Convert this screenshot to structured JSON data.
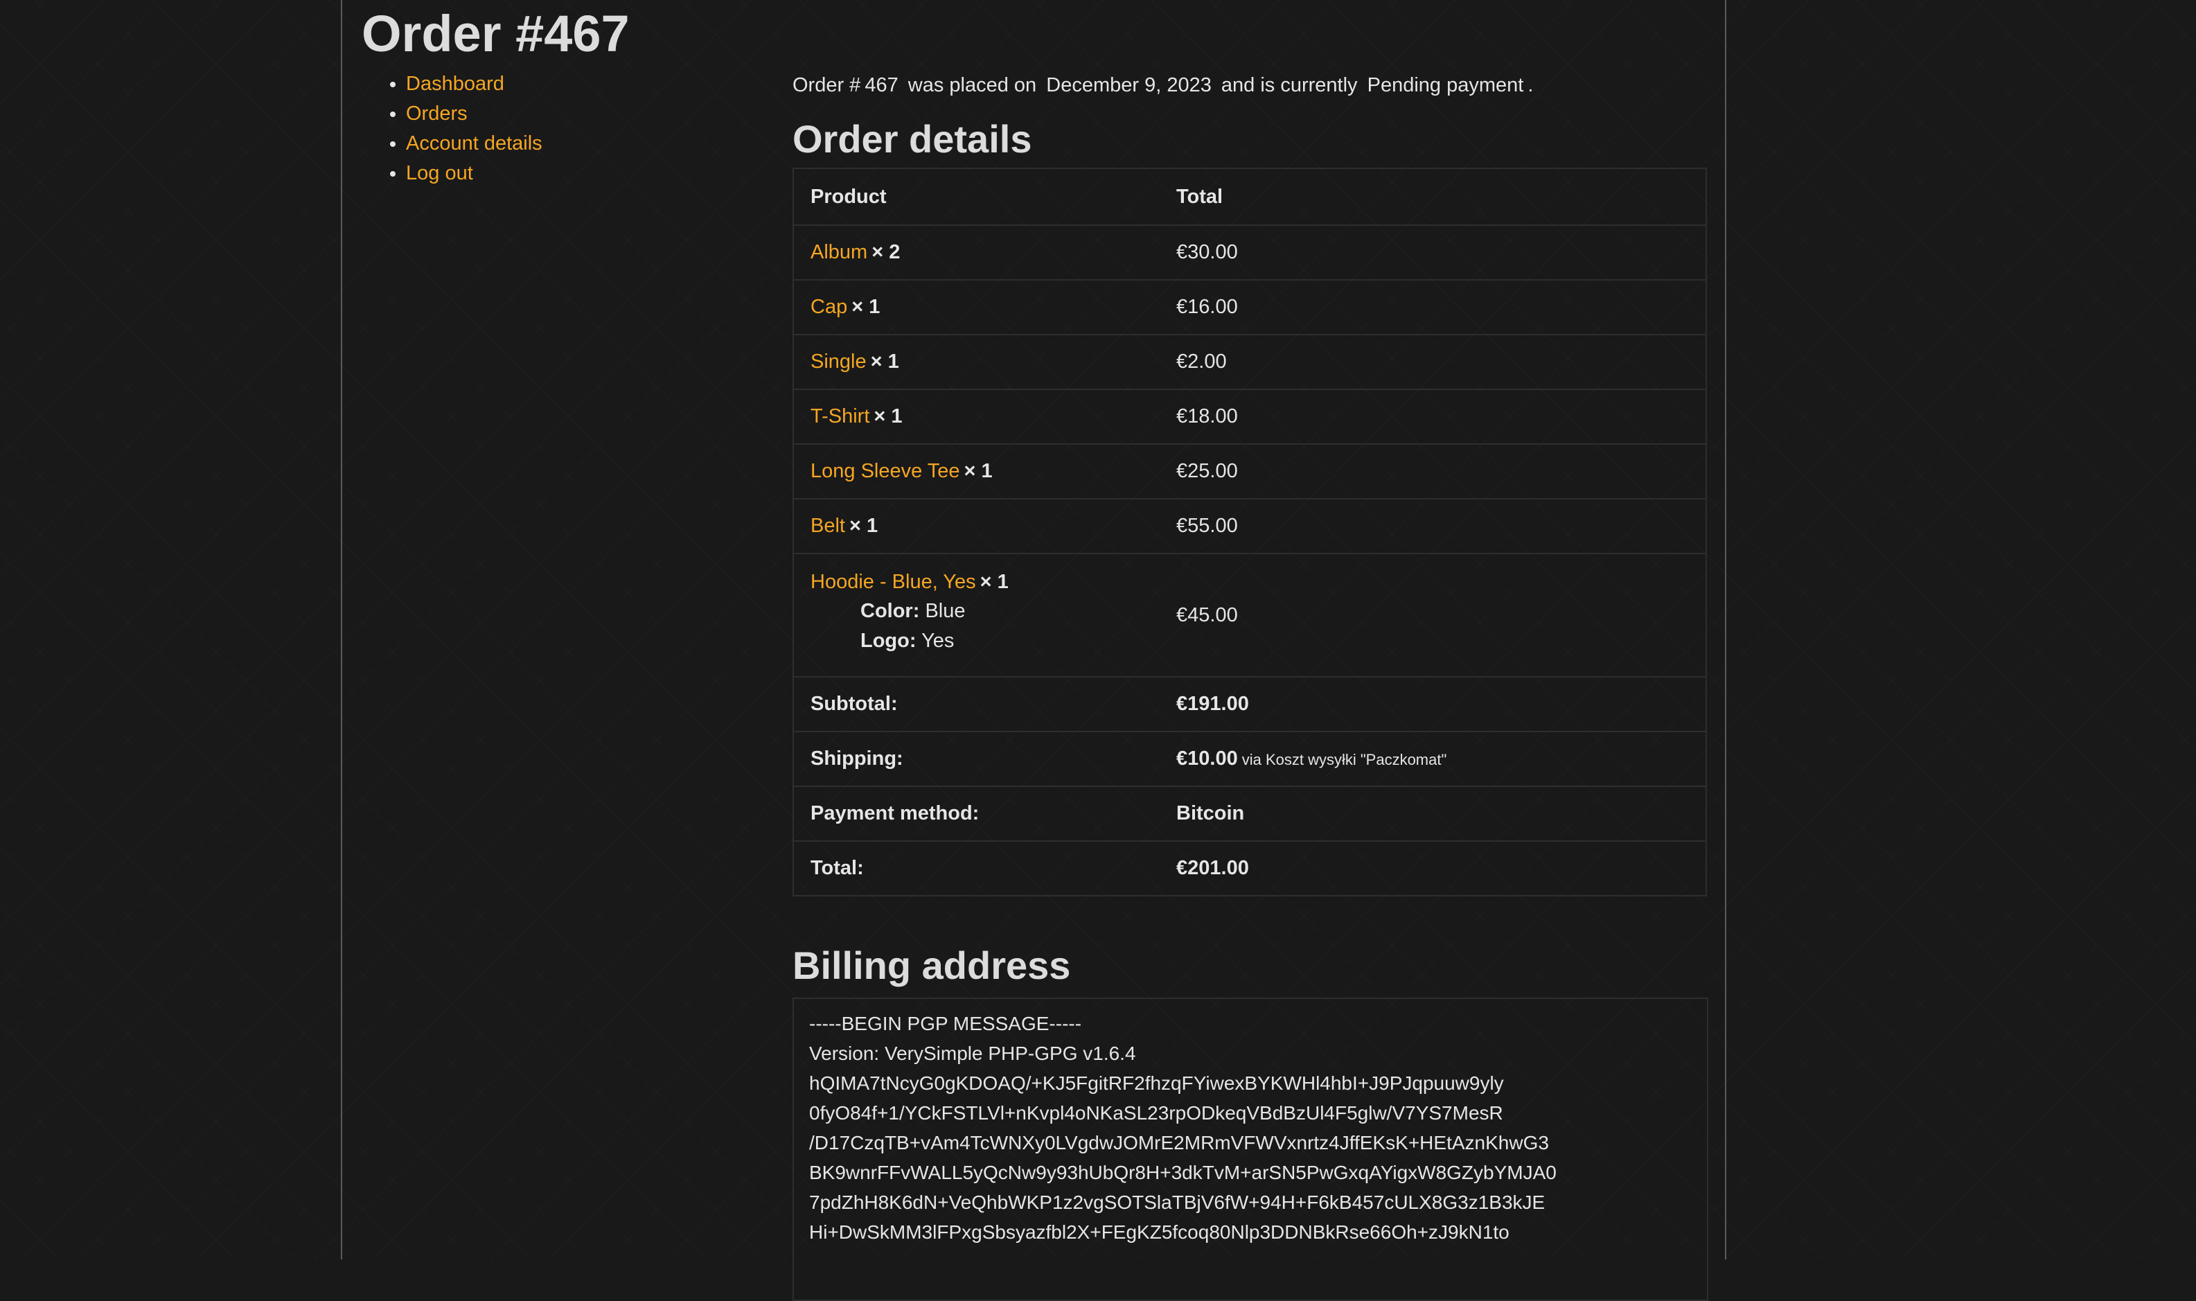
{
  "page": {
    "title": "Order #467"
  },
  "nav": {
    "items": [
      {
        "label": "Dashboard"
      },
      {
        "label": "Orders"
      },
      {
        "label": "Account details"
      },
      {
        "label": "Log out"
      }
    ]
  },
  "summary": {
    "prefix": "Order #",
    "order_number": "467",
    "placed_text": "was placed on",
    "order_date": "December 9, 2023",
    "status_text": "and is currently",
    "order_status": "Pending payment",
    "suffix": "."
  },
  "order_details": {
    "heading": "Order details",
    "col_product": "Product",
    "col_total": "Total",
    "items": [
      {
        "name": "Album",
        "qty": "× 2",
        "total": "€30.00"
      },
      {
        "name": "Cap",
        "qty": "× 1",
        "total": "€16.00"
      },
      {
        "name": "Single",
        "qty": "× 1",
        "total": "€2.00"
      },
      {
        "name": "T-Shirt",
        "qty": "× 1",
        "total": "€18.00"
      },
      {
        "name": "Long Sleeve Tee",
        "qty": "× 1",
        "total": "€25.00"
      },
      {
        "name": "Belt",
        "qty": "× 1",
        "total": "€55.00"
      },
      {
        "name": "Hoodie - Blue, Yes",
        "qty": "× 1",
        "total": "€45.00",
        "meta": [
          {
            "key": "Color:",
            "value": "Blue"
          },
          {
            "key": "Logo:",
            "value": "Yes"
          }
        ]
      }
    ],
    "subtotal_label": "Subtotal:",
    "subtotal_value": "€191.00",
    "shipping_label": "Shipping:",
    "shipping_value": "€10.00",
    "shipping_via": "via Koszt wysyłki \"Paczkomat\"",
    "payment_label": "Payment method:",
    "payment_value": "Bitcoin",
    "total_label": "Total:",
    "total_value": "€201.00"
  },
  "billing": {
    "heading": "Billing address",
    "lines": [
      "-----BEGIN PGP MESSAGE-----",
      "Version: VerySimple PHP-GPG v1.6.4",
      "hQIMA7tNcyG0gKDOAQ/+KJ5FgitRF2fhzqFYiwexBYKWHl4hbI+J9PJqpuuw9yly",
      "0fyO84f+1/YCkFSTLVl+nKvpl4oNKaSL23rpODkeqVBdBzUl4F5glw/V7YS7MesR",
      "/D17CzqTB+vAm4TcWNXy0LVgdwJOMrE2MRmVFWVxnrtz4JffEKsK+HEtAznKhwG3",
      "BK9wnrFFvWALL5yQcNw9y93hUbQr8H+3dkTvM+arSN5PwGxqAYigxW8GZybYMJA0",
      "7pdZhH8K6dN+VeQhbWKP1z2vgSOTSlaTBjV6fW+94H+F6kB457cULX8G3z1B3kJE",
      "Hi+DwSkMM3lFPxgSbsyazfbl2X+FEgKZ5fcoq80Nlp3DDNBkRse66Oh+zJ9kN1to"
    ]
  }
}
